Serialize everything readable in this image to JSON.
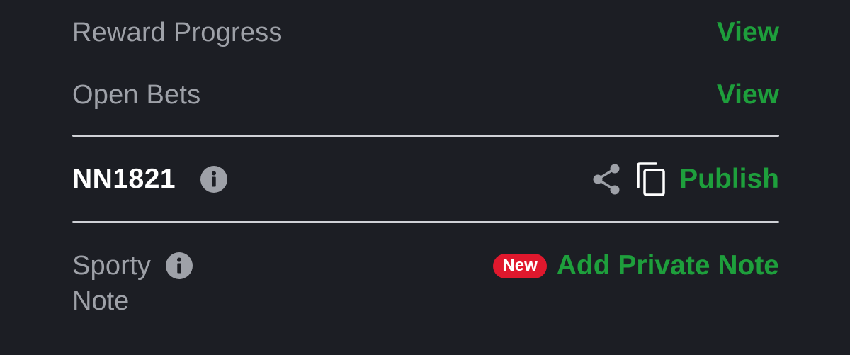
{
  "rows": {
    "reward_progress": {
      "label": "Reward Progress",
      "action": "View"
    },
    "open_bets": {
      "label": "Open Bets",
      "action": "View"
    }
  },
  "booking": {
    "code": "NN1821",
    "publish_label": "Publish"
  },
  "note": {
    "label_line1": "Sporty",
    "label_line2": "Note",
    "badge": "New",
    "action": "Add Private Note"
  },
  "icons": {
    "info": "info-circle-icon",
    "share": "share-icon",
    "copy": "copy-icon"
  },
  "colors": {
    "background": "#1c1e24",
    "accent_green": "#1e9f3c",
    "muted_text": "#9ea1a8",
    "badge_red": "#e0182d",
    "divider": "#cfd1d6"
  }
}
